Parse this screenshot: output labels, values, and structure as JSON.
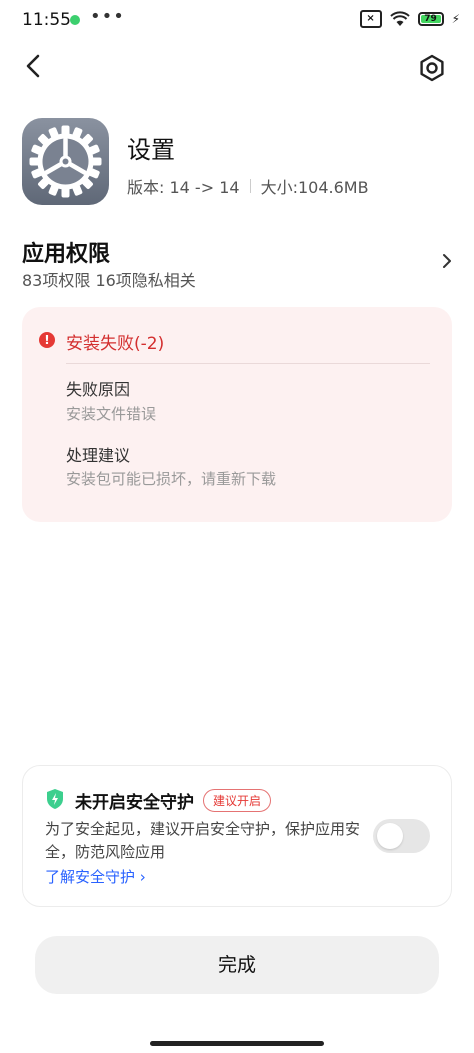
{
  "status_bar": {
    "time": "11:55",
    "battery": "79"
  },
  "app": {
    "name": "设置",
    "version": "版本: 14 -> 14",
    "size": "大小:104.6MB"
  },
  "permissions": {
    "title": "应用权限",
    "subtitle": "83项权限 16项隐私相关"
  },
  "error": {
    "title": "安装失败(-2)",
    "reason_label": "失败原因",
    "reason_value": "安装文件错误",
    "advice_label": "处理建议",
    "advice_value": "安装包可能已损坏，请重新下载"
  },
  "security": {
    "title": "未开启安全守护",
    "badge": "建议开启",
    "description": "为了安全起见，建议开启安全守护，保护应用安全，防范风险应用",
    "link": "了解安全守护",
    "enabled": false
  },
  "done_button": "完成",
  "colors": {
    "error": "#d32f2f",
    "link": "#2962ff",
    "shield": "#3ccf8e"
  }
}
